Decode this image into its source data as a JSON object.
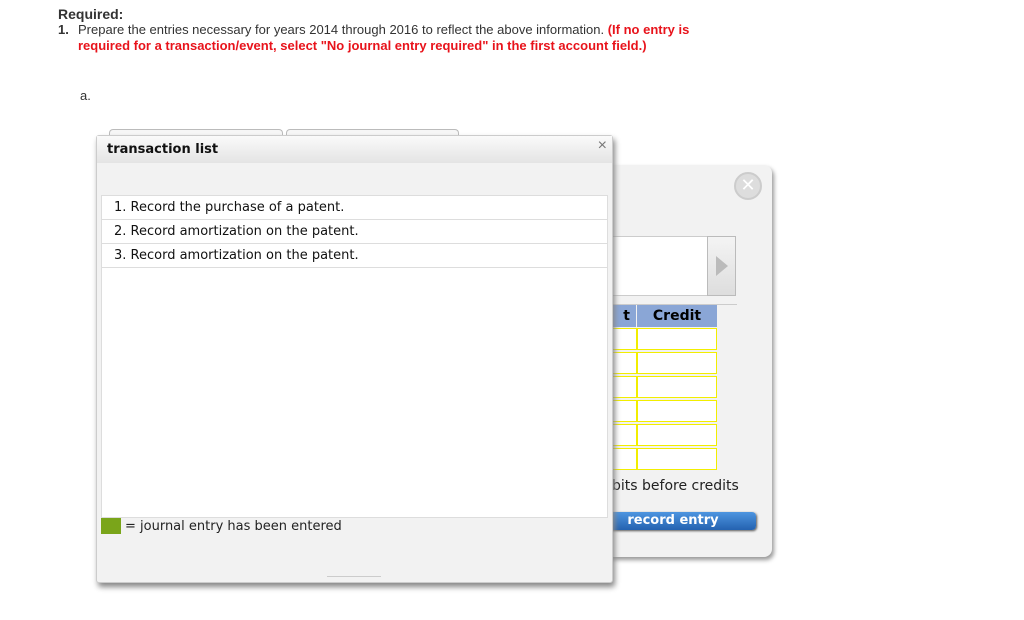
{
  "required": {
    "heading": "Required:",
    "number": "1.",
    "text": "Prepare the entries necessary for years 2014 through 2016 to reflect the above information.",
    "instruction": "(If no entry is required for a transaction/event, select \"No journal entry required\" in the first account field.)",
    "part": "a."
  },
  "journal_panel": {
    "close_icon": "x-circle-icon",
    "partial_header": "t",
    "credit_header": "Credit",
    "rows": 6,
    "note": "bits before credits",
    "record_label": "record entry",
    "cell_border_color": "#f2ee00",
    "header_color": "#8aa6d6"
  },
  "transaction_list": {
    "title": "transaction list",
    "close": "×",
    "items": [
      {
        "label": "1. Record the purchase of a patent."
      },
      {
        "label": "2. Record amortization on the patent."
      },
      {
        "label": "3. Record amortization on the patent."
      }
    ],
    "legend_text": "= journal entry has been entered",
    "legend_color": "#7aa51a"
  }
}
